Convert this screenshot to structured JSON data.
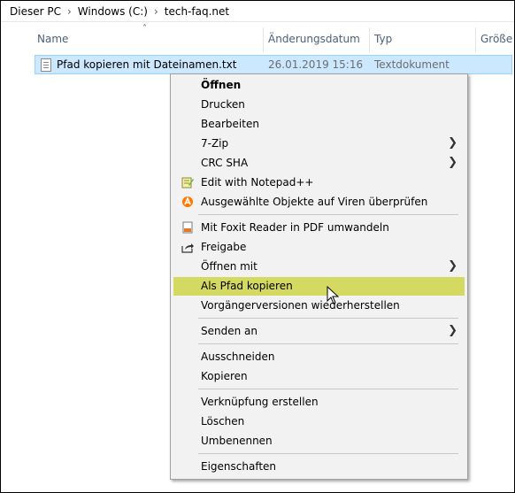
{
  "breadcrumb": {
    "items": [
      "Dieser PC",
      "Windows (C:)",
      "tech-faq.net"
    ]
  },
  "columns": {
    "name": "Name",
    "date": "Änderungsdatum",
    "type": "Typ",
    "size": "Größe"
  },
  "file": {
    "name": "Pfad kopieren mit Dateinamen.txt",
    "date": "26.01.2019 15:16",
    "type": "Textdokument"
  },
  "menu": {
    "open": "Öffnen",
    "print": "Drucken",
    "edit": "Bearbeiten",
    "zip": "7-Zip",
    "crc": "CRC SHA",
    "notepad": "Edit with Notepad++",
    "virus": "Ausgewählte Objekte auf Viren überprüfen",
    "foxit": "Mit Foxit Reader in PDF umwandeln",
    "share": "Freigabe",
    "open_with": "Öffnen mit",
    "copy_path": "Als Pfad kopieren",
    "restore": "Vorgängerversionen wiederherstellen",
    "send_to": "Senden an",
    "cut": "Ausschneiden",
    "copy": "Kopieren",
    "shortcut": "Verknüpfung erstellen",
    "delete": "Löschen",
    "rename": "Umbenennen",
    "properties": "Eigenschaften"
  },
  "colors": {
    "highlight": "#d4d962",
    "selection": "#cce8ff",
    "menu_bg": "#f2f2f2"
  },
  "icons": {
    "chevron": "chevron-right-icon",
    "file": "text-file-icon",
    "notepad": "notepad-plus-icon",
    "virus": "avast-icon",
    "foxit": "foxit-pdf-icon",
    "share": "share-icon"
  }
}
